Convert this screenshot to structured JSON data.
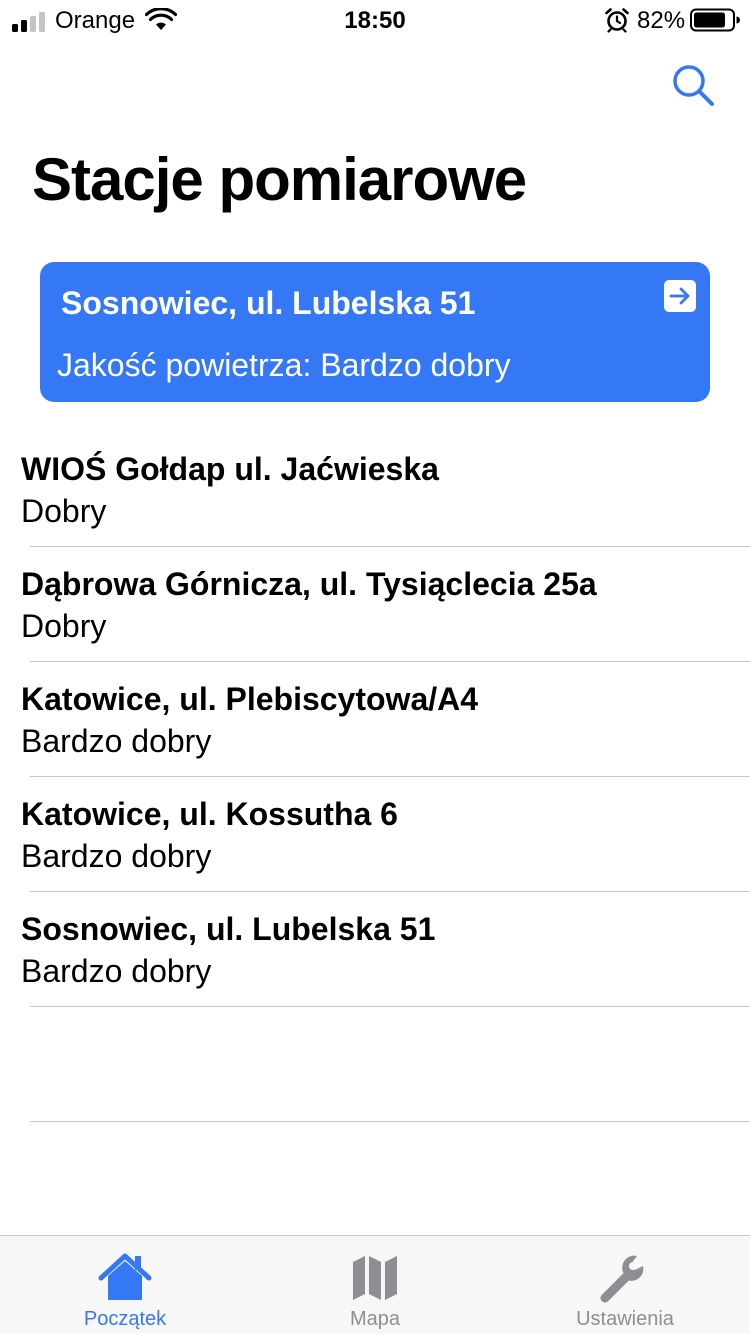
{
  "status_bar": {
    "carrier": "Orange",
    "time": "18:50",
    "battery_percent": "82%",
    "icons": [
      "signal-icon",
      "wifi-icon",
      "alarm-icon",
      "battery-icon"
    ]
  },
  "header": {
    "title": "Stacje pomiarowe",
    "search_icon": "search-icon"
  },
  "featured_station": {
    "name": "Sosnowiec, ul. Lubelska 51",
    "air_quality": "Jakość powietrza: Bardzo dobry",
    "icon": "open-arrow-icon"
  },
  "stations": [
    {
      "name": "WIOŚ Gołdap ul. Jaćwieska",
      "quality": "Dobry"
    },
    {
      "name": "Dąbrowa Górnicza, ul. Tysiąclecia 25a",
      "quality": "Dobry"
    },
    {
      "name": "Katowice, ul. Plebiscytowa/A4",
      "quality": "Bardzo dobry"
    },
    {
      "name": "Katowice, ul. Kossutha 6",
      "quality": "Bardzo dobry"
    },
    {
      "name": "Sosnowiec, ul. Lubelska 51",
      "quality": "Bardzo dobry"
    }
  ],
  "tab_bar": {
    "tabs": [
      {
        "label": "Początek",
        "icon": "home-icon",
        "active": true
      },
      {
        "label": "Mapa",
        "icon": "map-icon",
        "active": false
      },
      {
        "label": "Ustawienia",
        "icon": "wrench-icon",
        "active": false
      }
    ]
  },
  "colors": {
    "accent": "#3478f6",
    "tab_inactive": "#8e8e93",
    "separator": "#c8c7cc",
    "tab_bar_bg": "#f7f7f7"
  }
}
